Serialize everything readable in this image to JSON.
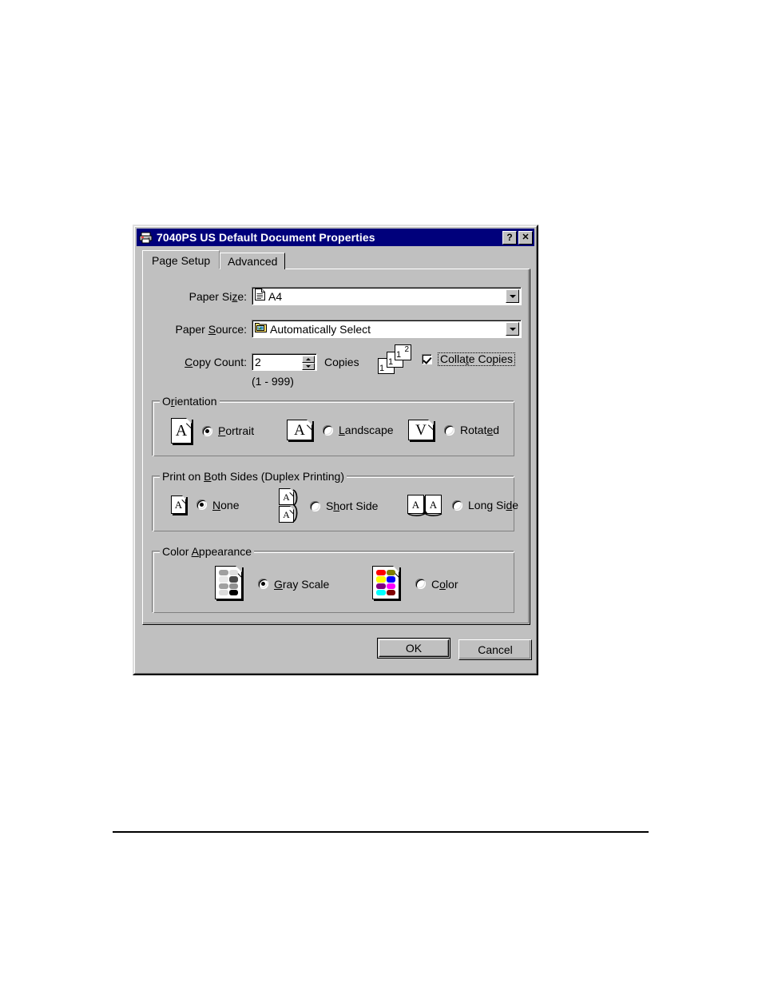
{
  "window": {
    "title": "7040PS US Default Document Properties",
    "icon": "printer-icon",
    "help_button": "?",
    "close_button": "✕",
    "titlebar_color": "#00007b"
  },
  "tabs": [
    {
      "label": "Page Setup",
      "active": true
    },
    {
      "label": "Advanced",
      "active": false
    }
  ],
  "page_setup": {
    "paper_size": {
      "label": "Paper Size:",
      "label_pre": "Paper Si",
      "label_accel": "z",
      "label_post": ":",
      "value": "A4",
      "icon": "document-icon"
    },
    "paper_source": {
      "label_pre": "Paper ",
      "label_accel": "S",
      "label_post": "ource:",
      "value": "Automatically Select",
      "icon": "paper-tray-icon"
    },
    "copy_count": {
      "label_pre": "",
      "label_accel": "C",
      "label_post": "opy Count:",
      "value": "2",
      "suffix": "Copies",
      "range_hint": "(1 - 999)"
    },
    "collate": {
      "label_pre": "Colla",
      "label_accel": "t",
      "label_post": "e Copies",
      "checked": true,
      "icon": "collated-pages-icon",
      "page_numbers": [
        "1",
        "2"
      ]
    },
    "orientation": {
      "title_pre": "O",
      "title_accel": "r",
      "title_post": "ientation",
      "selected": "Portrait",
      "options": [
        {
          "label_pre": "",
          "accel": "P",
          "label_post": "ortrait",
          "icon": "page-portrait-icon",
          "glyph": "A",
          "selected": true
        },
        {
          "label_pre": "",
          "accel": "L",
          "label_post": "andscape",
          "icon": "page-landscape-icon",
          "glyph": "A",
          "selected": false
        },
        {
          "label_pre": "Rotat",
          "accel": "e",
          "label_post": "d",
          "icon": "page-rotated-icon",
          "glyph": "V",
          "selected": false
        }
      ]
    },
    "duplex": {
      "title_pre": "Print on ",
      "title_accel": "B",
      "title_post": "oth Sides (Duplex Printing)",
      "selected": "None",
      "options": [
        {
          "label_pre": "",
          "accel": "N",
          "label_post": "one",
          "icon": "simplex-icon",
          "selected": true
        },
        {
          "label_pre": "S",
          "accel": "h",
          "label_post": "ort Side",
          "icon": "duplex-short-side-icon",
          "selected": false
        },
        {
          "label_pre": "Lon",
          "accel": "g",
          "label_post": " Si",
          "accel2": "d",
          "label_post2": "e",
          "icon": "duplex-long-side-icon",
          "selected": false
        }
      ]
    },
    "color_appearance": {
      "title_pre": "Color ",
      "title_accel": "A",
      "title_post": "ppearance",
      "selected": "Gray Scale",
      "options": [
        {
          "label_pre": "",
          "accel": "G",
          "label_post": "ray Scale",
          "icon": "grayscale-page-icon",
          "selected": true
        },
        {
          "label_pre": "C",
          "accel": "o",
          "label_post": "lor",
          "icon": "color-page-icon",
          "selected": false
        }
      ],
      "color_swatches": [
        "#ff0000",
        "#808000",
        "#ffff00",
        "#0000ff",
        "#800080",
        "#ff00ff",
        "#00ffff",
        "#800000"
      ],
      "gray_swatches": [
        "#a0a0a0",
        "#d8d8d8",
        "#e8e8e8",
        "#606060",
        "#a0a0a0",
        "#909090",
        "#d8d8d8",
        "#000000"
      ]
    }
  },
  "buttons": {
    "ok": "OK",
    "cancel": "Cancel"
  }
}
